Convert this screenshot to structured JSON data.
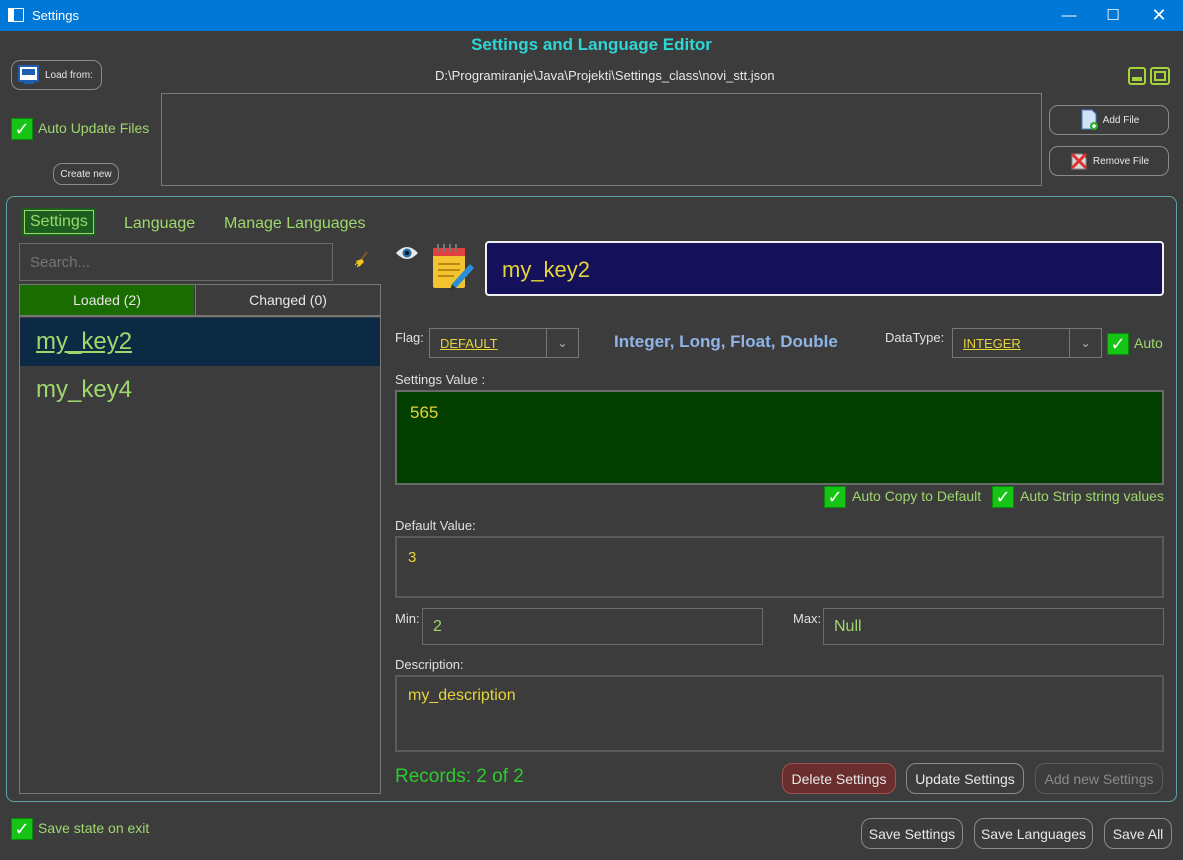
{
  "window": {
    "title": "Settings"
  },
  "header": {
    "title": "Settings and Language Editor",
    "load_from_label": "Load from:",
    "file_path": "D:\\Programiranje\\Java\\Projekti\\Settings_class\\novi_stt.json",
    "auto_update_label": "Auto Update Files",
    "create_new_label": "Create new",
    "add_file_label": "Add File",
    "remove_file_label": "Remove File"
  },
  "tabs": [
    {
      "label": "Settings",
      "active": true
    },
    {
      "label": "Language",
      "active": false
    },
    {
      "label": "Manage Languages",
      "active": false
    }
  ],
  "left_panel": {
    "search_placeholder": "Search...",
    "subtabs": [
      {
        "label": "Loaded (2)",
        "active": true
      },
      {
        "label": "Changed (0)",
        "active": false
      }
    ],
    "items": [
      {
        "label": "my_key2",
        "selected": true
      },
      {
        "label": "my_key4",
        "selected": false
      }
    ]
  },
  "editor": {
    "key": "my_key2",
    "flag_label": "Flag:",
    "flag_value": "DEFAULT",
    "types_hint": "Integer, Long, Float, Double",
    "datatype_label": "DataType:",
    "datatype_value": "INTEGER",
    "auto_label": "Auto",
    "settings_value_label": "Settings Value :",
    "settings_value": "565",
    "auto_copy_label": "Auto Copy to Default",
    "auto_strip_label": "Auto Strip string values",
    "default_value_label": "Default Value:",
    "default_value": "3",
    "min_label": "Min:",
    "min_value": "2",
    "max_label": "Max:",
    "max_value": "Null",
    "description_label": "Description:",
    "description_value": "my_description",
    "records_text": "Records: 2 of 2",
    "delete_label": "Delete Settings",
    "update_label": "Update Settings",
    "add_new_label": "Add new Settings"
  },
  "footer": {
    "save_state_label": "Save state on exit",
    "save_settings_label": "Save Settings",
    "save_languages_label": "Save Languages",
    "save_all_label": "Save All"
  },
  "colors": {
    "accent_cyan": "#2fd6d6",
    "green_text": "#9ed86d",
    "yellow_text": "#e6d43a",
    "key_box_bg": "#15105a",
    "value_box_bg": "#034000",
    "selected_item_bg": "#0d2a44",
    "checkbox_green": "#16c416"
  }
}
